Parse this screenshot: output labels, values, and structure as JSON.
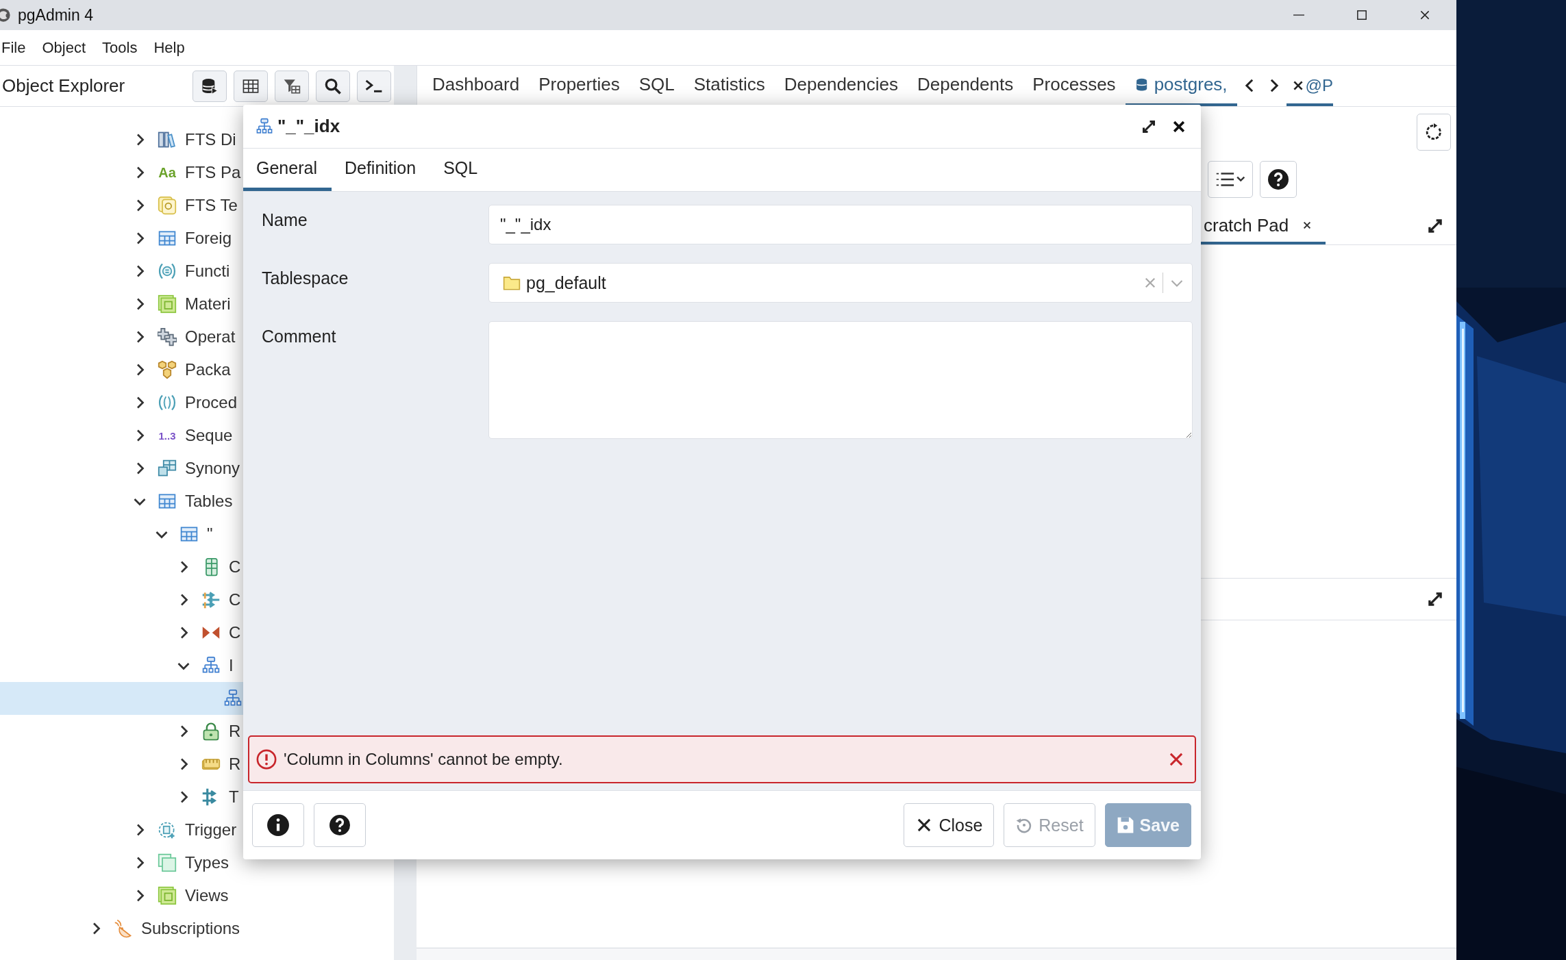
{
  "window": {
    "title": "pgAdmin 4"
  },
  "menu": [
    "File",
    "Object",
    "Tools",
    "Help"
  ],
  "object_explorer": {
    "title": "Object Explorer",
    "tree": [
      {
        "children": [
          {
            "children": [
              {
                "label": "FTS Di",
                "kind": "books",
                "expanded": false,
                "selected": false
              },
              {
                "label": "FTS Pa",
                "kind": "glyph",
                "glyph": "Aa",
                "expanded": false,
                "selected": false
              },
              {
                "label": "FTS Te",
                "kind": "search-doc",
                "expanded": false,
                "selected": false
              },
              {
                "label": "Foreig",
                "kind": "table",
                "expanded": false,
                "selected": false
              },
              {
                "label": "Functi",
                "kind": "braces",
                "expanded": false,
                "selected": false
              },
              {
                "label": "Materi",
                "kind": "squares",
                "expanded": false,
                "selected": false
              },
              {
                "label": "Operat",
                "kind": "crosses",
                "expanded": false,
                "selected": false
              },
              {
                "label": "Packa",
                "kind": "cubes",
                "expanded": false,
                "selected": false
              },
              {
                "label": "Proced",
                "kind": "parens",
                "expanded": false,
                "selected": false
              },
              {
                "label": "Seque",
                "kind": "glyph2",
                "glyph": "1..3",
                "expanded": false,
                "selected": false
              },
              {
                "label": "Synony",
                "kind": "table2",
                "expanded": false,
                "selected": false
              },
              {
                "label": "Tables",
                "kind": "table",
                "expanded": true,
                "selected": false,
                "children": [
                  {
                    "label": "\"",
                    "kind": "table",
                    "expanded": true,
                    "selected": false,
                    "children": [
                      {
                        "label": "C",
                        "kind": "columns",
                        "expanded": false,
                        "selected": false
                      },
                      {
                        "label": "C",
                        "kind": "arrows",
                        "expanded": false,
                        "selected": false
                      },
                      {
                        "label": "C",
                        "kind": "bowtie",
                        "expanded": false,
                        "selected": false
                      },
                      {
                        "label": "I",
                        "kind": "hierarchy",
                        "expanded": true,
                        "selected": false,
                        "children": [
                          {
                            "kind": "hierarchy",
                            "selected": true
                          }
                        ]
                      },
                      {
                        "label": "R",
                        "kind": "lock",
                        "expanded": false,
                        "selected": false
                      },
                      {
                        "label": "R",
                        "kind": "ruler",
                        "expanded": false,
                        "selected": false
                      },
                      {
                        "label": "T",
                        "kind": "arrows2",
                        "expanded": false,
                        "selected": false
                      }
                    ]
                  }
                ]
              },
              {
                "label": "Trigger",
                "kind": "gear-doc",
                "expanded": false,
                "selected": false
              },
              {
                "label": "Types",
                "kind": "types",
                "expanded": false,
                "selected": false
              },
              {
                "label": "Views",
                "kind": "squares",
                "expanded": false,
                "selected": false
              }
            ]
          }
        ]
      },
      {
        "label": "Subscriptions",
        "kind": "dish",
        "expanded": false,
        "selected": false
      }
    ]
  },
  "tabs": [
    {
      "label": "Dashboard",
      "kind": "panel",
      "selected": false
    },
    {
      "label": "Properties",
      "kind": "panel",
      "selected": false
    },
    {
      "label": "SQL",
      "kind": "panel",
      "selected": false
    },
    {
      "label": "Statistics",
      "kind": "panel",
      "selected": false
    },
    {
      "label": "Dependencies",
      "kind": "panel",
      "selected": false
    },
    {
      "label": "Dependents",
      "kind": "panel",
      "selected": false
    },
    {
      "label": "Processes",
      "kind": "panel",
      "selected": false
    },
    {
      "label": "postgres,",
      "kind": "query",
      "selected": true
    }
  ],
  "overflow_tab": {
    "label": "@P",
    "selected": true
  },
  "scratch_pad": {
    "label": "cratch Pad",
    "selected": true
  },
  "dialog": {
    "title": "\"_\"_idx",
    "tabs": [
      {
        "label": "General",
        "selected": true
      },
      {
        "label": "Definition",
        "selected": false
      },
      {
        "label": "SQL",
        "selected": false
      }
    ],
    "fields": [
      {
        "kind": "text",
        "label": "Name",
        "value": "\"_\"_idx"
      },
      {
        "kind": "select",
        "label": "Tablespace",
        "value": "pg_default"
      },
      {
        "kind": "textarea",
        "label": "Comment"
      }
    ],
    "error": "'Column in Columns' cannot be empty.",
    "buttons": [
      {
        "kind": "close",
        "label": "Close",
        "disabled": false
      },
      {
        "kind": "reset",
        "label": "Reset",
        "disabled": true
      },
      {
        "kind": "save",
        "label": "Save",
        "disabled": true
      }
    ]
  }
}
